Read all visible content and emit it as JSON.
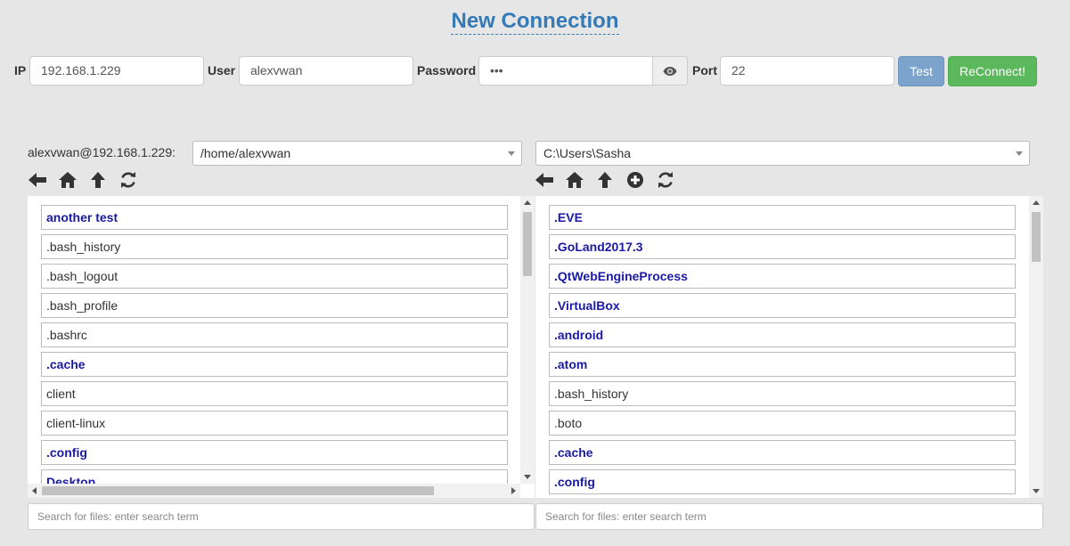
{
  "title": "New Connection",
  "connection": {
    "ip_label": "IP",
    "ip_value": "192.168.1.229",
    "user_label": "User",
    "user_value": "alexvwan",
    "password_label": "Password",
    "password_value": "•••",
    "port_label": "Port",
    "port_value": "22",
    "test_label": "Test",
    "reconnect_label": "ReConnect!"
  },
  "remote": {
    "host_label": "alexvwan@192.168.1.229:",
    "path": "/home/alexvwan",
    "toolbar": [
      "arrow-left-icon",
      "home-icon",
      "arrow-up-icon",
      "refresh-icon"
    ],
    "files": [
      {
        "name": "another test",
        "dir": true
      },
      {
        "name": ".bash_history",
        "dir": false
      },
      {
        "name": ".bash_logout",
        "dir": false
      },
      {
        "name": ".bash_profile",
        "dir": false
      },
      {
        "name": ".bashrc",
        "dir": false
      },
      {
        "name": ".cache",
        "dir": true
      },
      {
        "name": "client",
        "dir": false
      },
      {
        "name": "client-linux",
        "dir": false
      },
      {
        "name": ".config",
        "dir": true
      },
      {
        "name": "Desktop",
        "dir": true
      }
    ],
    "search_placeholder": "Search for files: enter search term"
  },
  "local": {
    "path": "C:\\Users\\Sasha",
    "toolbar": [
      "arrow-left-icon",
      "home-icon",
      "arrow-up-icon",
      "plus-circle-icon",
      "refresh-icon"
    ],
    "files": [
      {
        "name": ".EVE",
        "dir": true
      },
      {
        "name": ".GoLand2017.3",
        "dir": true
      },
      {
        "name": ".QtWebEngineProcess",
        "dir": true
      },
      {
        "name": ".VirtualBox",
        "dir": true
      },
      {
        "name": ".android",
        "dir": true
      },
      {
        "name": ".atom",
        "dir": true
      },
      {
        "name": ".bash_history",
        "dir": false
      },
      {
        "name": ".boto",
        "dir": false
      },
      {
        "name": ".cache",
        "dir": true
      },
      {
        "name": ".config",
        "dir": true
      }
    ],
    "search_placeholder": "Search for files: enter search term"
  },
  "colors": {
    "title": "#337ab7",
    "directory": "#1a1aa6",
    "test_button": "#7ba3cc",
    "reconnect_button": "#5cb85c"
  }
}
